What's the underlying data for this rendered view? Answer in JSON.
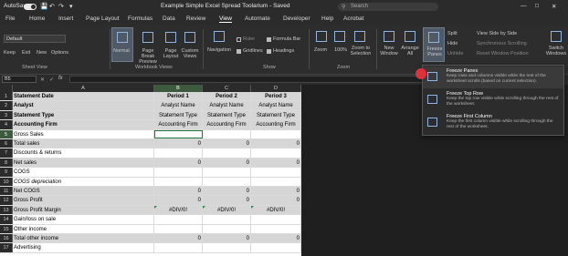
{
  "titlebar": {
    "autosave_label": "AutoSave",
    "autosave_state": "On",
    "doc_title": "Example Simple Excel Spread Toolarium - Saved",
    "search_label": "Search"
  },
  "tabs": [
    "File",
    "Home",
    "Insert",
    "Page Layout",
    "Formulas",
    "Data",
    "Review",
    "View",
    "Automate",
    "Developer",
    "Help",
    "Acrobat"
  ],
  "active_tab": "View",
  "ribbon": {
    "sheet_view": {
      "dropdown": "Default",
      "keep": "Keep",
      "exit": "Exit",
      "new": "New",
      "options": "Options",
      "label": "Sheet View"
    },
    "workbook_views": {
      "normal": "Normal",
      "page_break": "Page Break Preview",
      "page_layout": "Page Layout",
      "custom": "Custom Views",
      "label": "Workbook Views"
    },
    "show": {
      "navigation": "Navigation",
      "ruler": "Ruler",
      "formula_bar": "Formula Bar",
      "gridlines": "Gridlines",
      "headings": "Headings",
      "label": "Show"
    },
    "zoom": {
      "zoom": "Zoom",
      "hundred": "100%",
      "to_selection": "Zoom to Selection",
      "label": "Zoom"
    },
    "window": {
      "new_window": "New Window",
      "arrange_all": "Arrange All",
      "freeze_panes": "Freeze Panes",
      "split": "Split",
      "hide": "Hide",
      "unhide": "Unhide",
      "side_by_side": "View Side by Side",
      "sync_scroll": "Synchronous Scrolling",
      "reset_pos": "Reset Window Position",
      "switch": "Switch Windows"
    }
  },
  "formula_bar": {
    "name_box": "B5",
    "fx": "fx"
  },
  "columns": [
    "A",
    "B",
    "C",
    "D"
  ],
  "rows": [
    {
      "n": "1",
      "a": "Statement Date",
      "b": "Period 1",
      "c": "Period 2",
      "d": "Period 3",
      "style": "hdr"
    },
    {
      "n": "2",
      "a": "Analyst",
      "b": "Analyst Name",
      "c": "Analyst Name",
      "d": "Analyst Name",
      "style": "hdr2"
    },
    {
      "n": "3",
      "a": "Statement Type",
      "b": "Statement Type",
      "c": "Statement Type",
      "d": "Statement Type",
      "style": "hdr2"
    },
    {
      "n": "4",
      "a": "Accounting Firm",
      "b": "Accounting Firm",
      "c": "Accounting Firm",
      "d": "Accounting Firm",
      "style": "hdr2"
    },
    {
      "n": "5",
      "a": "Gross Sales",
      "b": "",
      "c": "",
      "d": "",
      "style": "plain"
    },
    {
      "n": "6",
      "a": "Total sales",
      "b": "0",
      "c": "0",
      "d": "0",
      "style": "shade"
    },
    {
      "n": "7",
      "a": "Discounts & returns",
      "b": "",
      "c": "",
      "d": "",
      "style": "plain"
    },
    {
      "n": "8",
      "a": "Net sales",
      "b": "0",
      "c": "0",
      "d": "0",
      "style": "shade"
    },
    {
      "n": "9",
      "a": "COGS",
      "b": "",
      "c": "",
      "d": "",
      "style": "plain"
    },
    {
      "n": "10",
      "a": "COGS depreciation",
      "b": "",
      "c": "",
      "d": "",
      "style": "italic"
    },
    {
      "n": "11",
      "a": "Net COGS",
      "b": "0",
      "c": "0",
      "d": "0",
      "style": "shade"
    },
    {
      "n": "12",
      "a": "Gross Profit",
      "b": "0",
      "c": "0",
      "d": "0",
      "style": "shade"
    },
    {
      "n": "13",
      "a": "Gross Profit Margin",
      "b": "#DIV/0!",
      "c": "#DIV/0!",
      "d": "#DIV/0!",
      "style": "err"
    },
    {
      "n": "14",
      "a": "Gain/loss on sale",
      "b": "",
      "c": "",
      "d": "",
      "style": "plain"
    },
    {
      "n": "15",
      "a": "Other income",
      "b": "",
      "c": "",
      "d": "",
      "style": "plain"
    },
    {
      "n": "16",
      "a": "Total other income",
      "b": "0",
      "c": "0",
      "d": "0",
      "style": "shade"
    },
    {
      "n": "17",
      "a": "Advertising",
      "b": "",
      "c": "",
      "d": "",
      "style": "plain"
    }
  ],
  "freeze_menu": [
    {
      "title": "Freeze Panes",
      "desc": "Keep rows and columns visible while the rest of the worksheet scrolls (based on current selection)."
    },
    {
      "title": "Freeze Top Row",
      "desc": "Keep the top row visible while scrolling through the rest of the worksheet."
    },
    {
      "title": "Freeze First Column",
      "desc": "Keep the first column visible while scrolling through the rest of the worksheet."
    }
  ],
  "colors": {
    "accent": "#1e7a3a",
    "error_flag": "#1e8a3a",
    "highlight_dot": "#e0303a"
  }
}
